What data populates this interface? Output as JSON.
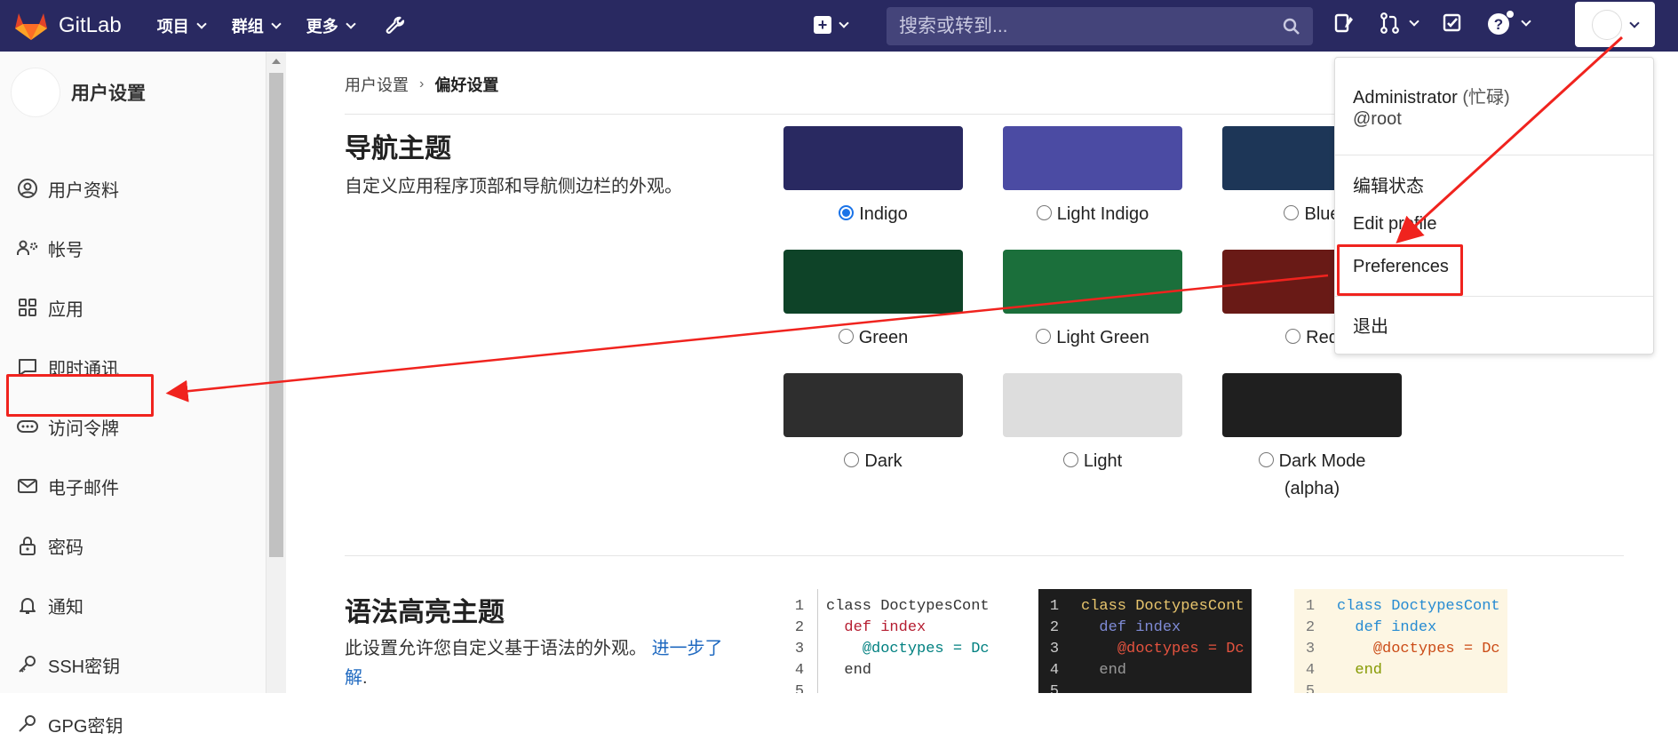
{
  "app": {
    "brand": "GitLab"
  },
  "topnav": {
    "items": [
      {
        "label": "项目"
      },
      {
        "label": "群组"
      },
      {
        "label": "更多"
      }
    ]
  },
  "search": {
    "placeholder": "搜索或转到..."
  },
  "sidebar": {
    "title": "用户设置",
    "items": [
      {
        "label": "用户资料",
        "icon": "profile-icon"
      },
      {
        "label": "帐号",
        "icon": "account-icon"
      },
      {
        "label": "应用",
        "icon": "applications-icon"
      },
      {
        "label": "即时通讯",
        "icon": "chat-icon"
      },
      {
        "label": "访问令牌",
        "icon": "token-icon"
      },
      {
        "label": "电子邮件",
        "icon": "mail-icon"
      },
      {
        "label": "密码",
        "icon": "lock-icon"
      },
      {
        "label": "通知",
        "icon": "bell-icon"
      },
      {
        "label": "SSH密钥",
        "icon": "key-icon"
      },
      {
        "label": "GPG密钥",
        "icon": "key-icon"
      }
    ]
  },
  "breadcrumb": {
    "parent": "用户设置",
    "sep": "›",
    "current": "偏好设置"
  },
  "nav_theme": {
    "title": "导航主题",
    "description": "自定义应用程序顶部和导航侧边栏的外观。",
    "themes": [
      {
        "label": "Indigo",
        "color": "#292961",
        "selected": true
      },
      {
        "label": "Light Indigo",
        "color": "#4b4ba3",
        "selected": false
      },
      {
        "label": "Blue",
        "color": "#1d3657",
        "selected": false
      },
      {
        "label": "Green",
        "color": "#0e4328",
        "selected": false
      },
      {
        "label": "Light Green",
        "color": "#1b6f3b",
        "selected": false
      },
      {
        "label": "Red",
        "color": "#691a16",
        "selected": false
      },
      {
        "label": "Dark",
        "color": "#2e2e2e",
        "selected": false
      },
      {
        "label": "Light",
        "color": "#dddddd",
        "selected": false
      },
      {
        "label": "Dark Mode",
        "label2": "(alpha)",
        "color": "#1f1f1f",
        "selected": false
      }
    ]
  },
  "syntax_theme": {
    "title": "语法高亮主题",
    "description": "此设置允许您自定义基于语法的外观。",
    "link_line1": "进一步了",
    "link_line2": "解",
    "link_tail": ".",
    "code_lines": [
      "class DoctypesCont",
      "def index",
      "@doctypes = Dc",
      "end",
      ""
    ]
  },
  "user_menu": {
    "name": "Administrator",
    "status": "(忙碌)",
    "username": "@root",
    "items": [
      "编辑状态",
      "Edit profile",
      "Preferences",
      "退出"
    ]
  }
}
